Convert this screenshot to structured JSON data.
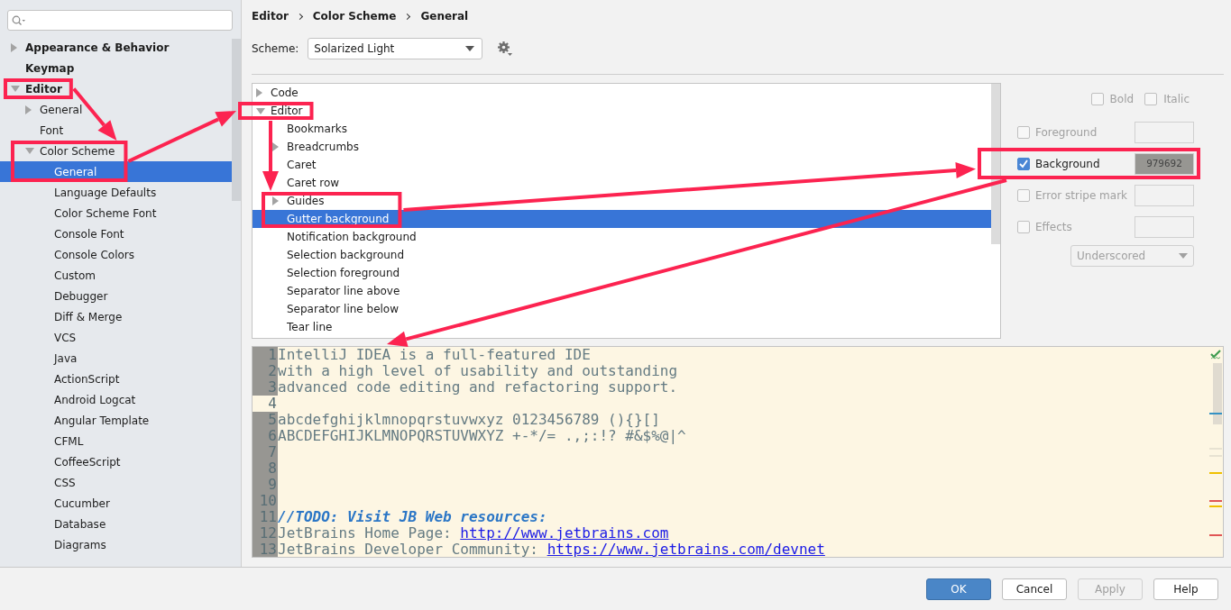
{
  "sidebar": {
    "items": [
      {
        "label": "Appearance & Behavior",
        "expanded": false,
        "selected": false
      },
      {
        "label": "Keymap",
        "selected": false
      },
      {
        "label": "Editor",
        "expanded": true,
        "selected": false,
        "children": [
          {
            "label": "General",
            "expanded": false,
            "selected": false
          },
          {
            "label": "Font",
            "selected": false
          },
          {
            "label": "Color Scheme",
            "expanded": true,
            "selected": false,
            "children": [
              {
                "label": "General",
                "selected": true
              },
              {
                "label": "Language Defaults",
                "selected": false
              },
              {
                "label": "Color Scheme Font",
                "selected": false
              },
              {
                "label": "Console Font",
                "selected": false
              },
              {
                "label": "Console Colors",
                "selected": false
              },
              {
                "label": "Custom",
                "selected": false
              },
              {
                "label": "Debugger",
                "selected": false
              },
              {
                "label": "Diff & Merge",
                "selected": false
              },
              {
                "label": "VCS",
                "selected": false
              },
              {
                "label": "Java",
                "selected": false
              },
              {
                "label": "ActionScript",
                "selected": false
              },
              {
                "label": "Android Logcat",
                "selected": false
              },
              {
                "label": "Angular Template",
                "selected": false
              },
              {
                "label": "CFML",
                "selected": false
              },
              {
                "label": "CoffeeScript",
                "selected": false
              },
              {
                "label": "CSS",
                "selected": false
              },
              {
                "label": "Cucumber",
                "selected": false
              },
              {
                "label": "Database",
                "selected": false
              },
              {
                "label": "Diagrams",
                "selected": false
              }
            ]
          }
        ]
      }
    ]
  },
  "breadcrumb": [
    "Editor",
    "Color Scheme",
    "General"
  ],
  "scheme": {
    "label": "Scheme:",
    "value": "Solarized Light"
  },
  "attribute_tree": {
    "items": [
      {
        "label": "Code",
        "expanded": false,
        "selected": false
      },
      {
        "label": "Editor",
        "expanded": true,
        "selected": false,
        "children": [
          {
            "label": "Bookmarks",
            "selected": false
          },
          {
            "label": "Breadcrumbs",
            "expanded": false,
            "selected": false
          },
          {
            "label": "Caret",
            "selected": false
          },
          {
            "label": "Caret row",
            "selected": false
          },
          {
            "label": "Guides",
            "expanded": false,
            "selected": false
          },
          {
            "label": "Gutter background",
            "selected": true
          },
          {
            "label": "Notification background",
            "selected": false
          },
          {
            "label": "Selection background",
            "selected": false
          },
          {
            "label": "Selection foreground",
            "selected": false
          },
          {
            "label": "Separator line above",
            "selected": false
          },
          {
            "label": "Separator line below",
            "selected": false
          },
          {
            "label": "Tear line",
            "selected": false
          }
        ]
      }
    ]
  },
  "attributes": {
    "styles": [
      {
        "label": "Bold",
        "checked": false
      },
      {
        "label": "Italic",
        "checked": false
      }
    ],
    "rows": [
      {
        "label": "Foreground",
        "checked": false
      },
      {
        "label": "Background",
        "checked": true,
        "value": "979692",
        "color": "#979692"
      },
      {
        "label": "Error stripe mark",
        "checked": false
      },
      {
        "label": "Effects",
        "checked": false
      }
    ],
    "effect_type": {
      "value": "Underscored",
      "disabled": true
    }
  },
  "preview": {
    "lines": [
      {
        "number": "1",
        "caret_row": false,
        "segments": [
          {
            "kind": "text",
            "text": "IntelliJ IDEA is a full-featured IDE"
          }
        ]
      },
      {
        "number": "2",
        "caret_row": false,
        "segments": [
          {
            "kind": "text",
            "text": "with a high level of usability and outstanding"
          }
        ]
      },
      {
        "number": "3",
        "caret_row": false,
        "segments": [
          {
            "kind": "text",
            "text": "advanced code editing and refactoring support."
          }
        ]
      },
      {
        "number": "4",
        "caret_row": true
      },
      {
        "number": "5",
        "caret_row": false,
        "segments": [
          {
            "kind": "text",
            "text": "abcdefghijklmnopqrstuvwxyz 0123456789 (){}[]"
          }
        ]
      },
      {
        "number": "6",
        "caret_row": false,
        "segments": [
          {
            "kind": "text",
            "text": "ABCDEFGHIJKLMNOPQRSTUVWXYZ +-*/= .,;:!? #&$%@|^"
          }
        ]
      },
      {
        "number": "7",
        "caret_row": false
      },
      {
        "number": "8",
        "caret_row": false
      },
      {
        "number": "9",
        "caret_row": false
      },
      {
        "number": "10",
        "caret_row": false
      },
      {
        "number": "11",
        "caret_row": false,
        "segments": [
          {
            "kind": "comment",
            "text": "//TODO: Visit JB Web resources:"
          }
        ]
      },
      {
        "number": "12",
        "caret_row": false,
        "segments": [
          {
            "kind": "text",
            "text": "JetBrains Home Page: "
          },
          {
            "kind": "link",
            "text": "http://www.jetbrains.com"
          }
        ]
      },
      {
        "number": "13",
        "caret_row": false,
        "segments": [
          {
            "kind": "text",
            "text": "JetBrains Developer Community: "
          },
          {
            "kind": "link",
            "text": "https://www.jetbrains.com/devnet"
          }
        ]
      }
    ]
  },
  "buttons": [
    {
      "label": "OK",
      "kind": "primary",
      "disabled": false
    },
    {
      "label": "Cancel",
      "kind": "normal",
      "disabled": false
    },
    {
      "label": "Apply",
      "kind": "normal",
      "disabled": true
    },
    {
      "label": "Help",
      "kind": "normal",
      "disabled": false
    }
  ]
}
